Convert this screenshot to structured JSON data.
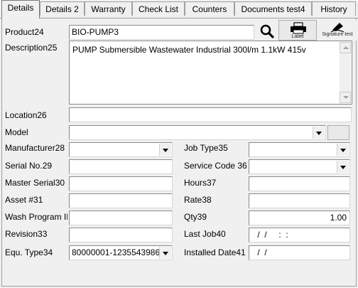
{
  "tabs": [
    {
      "label": "Details"
    },
    {
      "label": "Details 2"
    },
    {
      "label": "Warranty"
    },
    {
      "label": "Check List"
    },
    {
      "label": "Counters"
    },
    {
      "label": "Documents test4"
    },
    {
      "label": "History"
    }
  ],
  "product": {
    "label": "Product24",
    "value": "BIO-PUMP3"
  },
  "toolbar": {
    "label_caption": "Label",
    "signature_caption": "Signature test"
  },
  "description": {
    "label": "Description25",
    "value": "PUMP Submersible Wastewater Industrial 300l/m  1.1kW 415v"
  },
  "location": {
    "label": "Location26",
    "value": ""
  },
  "model": {
    "label": "Model",
    "value": ""
  },
  "left_fields": [
    {
      "label": "Manufacturer28",
      "value": ""
    },
    {
      "label": "Serial No.29",
      "value": ""
    },
    {
      "label": "Master Serial30",
      "value": ""
    },
    {
      "label": "Asset #31",
      "value": ""
    },
    {
      "label": "Wash Program ID",
      "value": ""
    },
    {
      "label": "Revision33",
      "value": ""
    },
    {
      "label": "Equ. Type34",
      "value": "80000001-1235543986"
    }
  ],
  "right_fields": [
    {
      "label": "Job Type35",
      "value": ""
    },
    {
      "label": "Service Code 36",
      "value": ""
    },
    {
      "label": "Hours37",
      "value": ""
    },
    {
      "label": "Rate38",
      "value": ""
    },
    {
      "label": "Qty39",
      "value": "1.00"
    },
    {
      "label": "Last Job40",
      "value": " /  /     :  :"
    },
    {
      "label": "Installed Date41",
      "value": " /  /"
    }
  ]
}
